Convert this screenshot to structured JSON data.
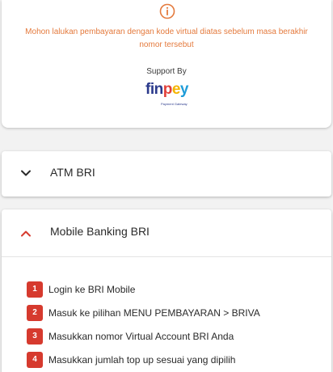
{
  "notice": {
    "icon": "info-icon",
    "message": "Mohon lalukan pembayaran dengan kode virtual diatas sebelum masa berakhir nomor tersebut",
    "color": "#e47a3d"
  },
  "support": {
    "label": "Support By",
    "logo": {
      "part1": "fin",
      "part2": "p",
      "part3": "e",
      "part4": "y",
      "tagline": "Payment Gateway"
    }
  },
  "accordion": [
    {
      "title": "ATM BRI",
      "expanded": false,
      "icon": "chevron-down-icon"
    },
    {
      "title": "Mobile Banking BRI",
      "expanded": true,
      "icon": "chevron-up-icon",
      "steps": [
        {
          "num": "1",
          "text": "Login ke BRI Mobile"
        },
        {
          "num": "2",
          "text": "Masuk ke pilihan MENU PEMBAYARAN > BRIVA"
        },
        {
          "num": "3",
          "text": "Masukkan nomor Virtual Account BRI Anda"
        },
        {
          "num": "4",
          "text": "Masukkan jumlah top up sesuai yang dipilih"
        }
      ]
    }
  ],
  "colors": {
    "accent": "#d63a2e",
    "notice_text": "#e47a3d",
    "brand_blue": "#2b3a8c"
  }
}
